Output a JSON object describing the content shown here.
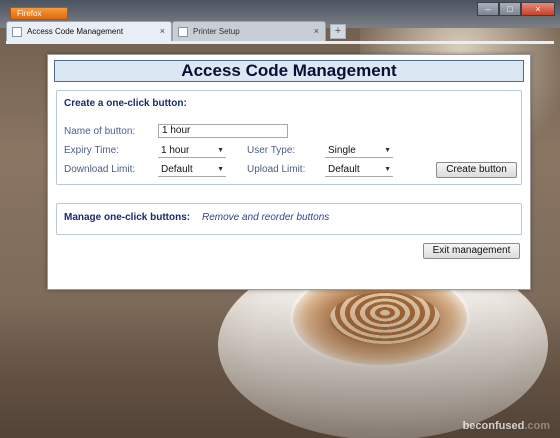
{
  "browser": {
    "app_button_label": "Firefox",
    "tabs": [
      {
        "label": "Access Code Management",
        "close": "×"
      },
      {
        "label": "Printer Setup",
        "close": "×"
      }
    ],
    "new_tab": "+",
    "window_controls": {
      "minimize": "–",
      "maximize": "□",
      "close": "×"
    }
  },
  "dialog": {
    "title": "Access Code Management",
    "create_section": {
      "title": "Create a one-click button:",
      "name_label": "Name of button:",
      "name_value": "1 hour",
      "expiry_label": "Expiry Time:",
      "expiry_value": "1 hour",
      "user_type_label": "User Type:",
      "user_type_value": "Single",
      "download_label": "Download Limit:",
      "download_value": "Default",
      "upload_label": "Upload Limit:",
      "upload_value": "Default",
      "create_button": "Create button"
    },
    "manage_section": {
      "title": "Manage one-click buttons:",
      "subtitle": "Remove and reorder buttons"
    },
    "exit_button": "Exit management"
  },
  "watermark": {
    "main": "beconfused",
    "dim": ".com"
  },
  "icons": {
    "dropdown_arrow": "▼"
  }
}
